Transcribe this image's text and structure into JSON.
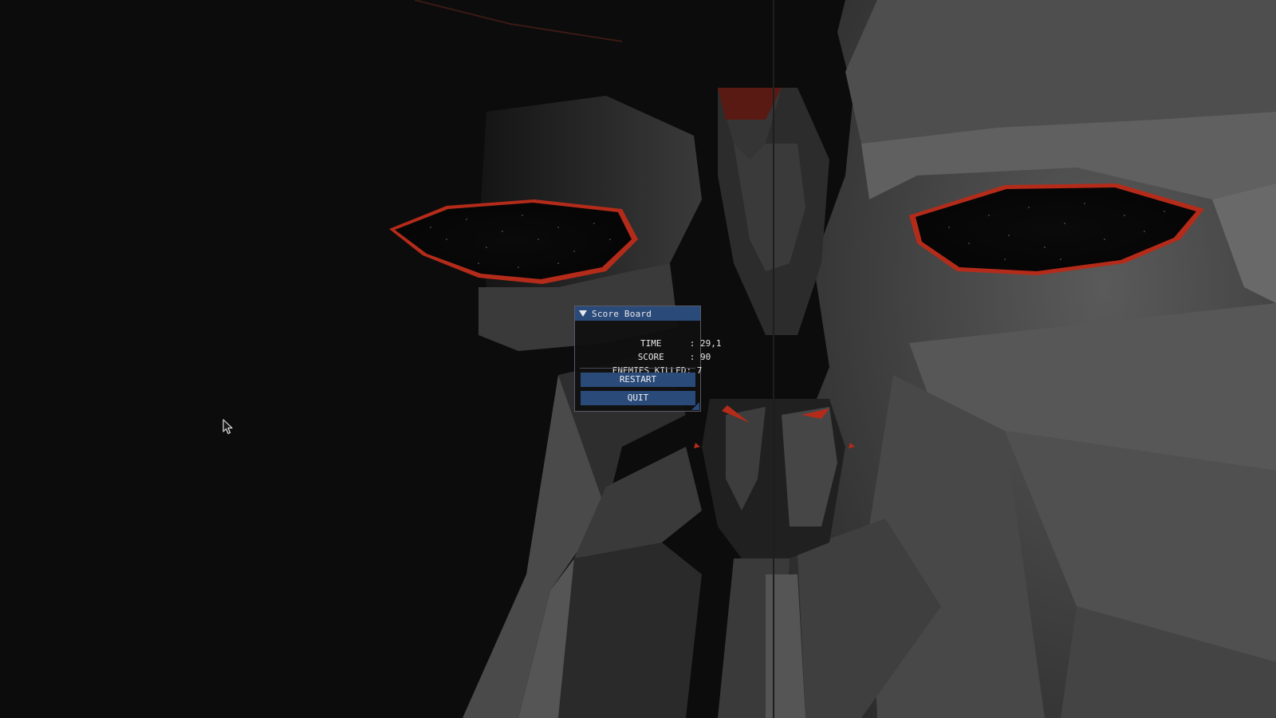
{
  "scoreboard": {
    "title": "Score Board",
    "time_label": "TIME",
    "time_value": ": 29,1",
    "score_label": "SCORE",
    "score_value": ": 90",
    "enemies_label": "ENEMIES KILLED:",
    "enemies_value": "7",
    "restart_label": "RESTART",
    "quit_label": "QUIT"
  },
  "colors": {
    "background": "#0c0c0c",
    "titlebar": "#2a4a7a",
    "button": "#2a4a7a",
    "eye_glow": "#c0301a"
  },
  "icons": {
    "collapse": "triangle-down-icon",
    "cursor": "mouse-pointer-icon",
    "resize": "resize-grip-icon"
  }
}
